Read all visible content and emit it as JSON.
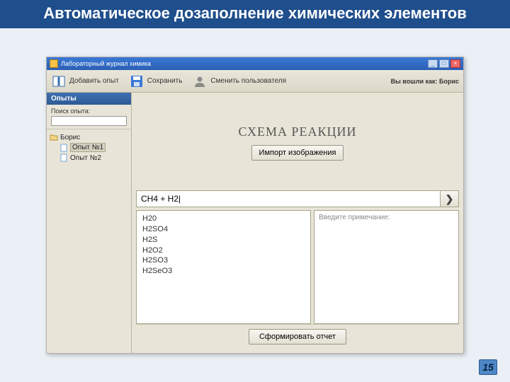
{
  "slide": {
    "title": "Автоматическое дозаполнение химических элементов",
    "page": "15"
  },
  "titlebar": {
    "caption": "Лабораторный журнал химика"
  },
  "toolbar": {
    "add": "Добавить опыт",
    "save": "Сохранить",
    "switchUser": "Сменить пользователя",
    "loggedIn": "Вы вошли как: Борис"
  },
  "sidebar": {
    "header": "Опыты",
    "searchLabel": "Поиск опыта:",
    "tree": {
      "root": "Борис",
      "items": [
        "Опыт №1",
        "Опыт №2"
      ],
      "selectedIndex": 0
    }
  },
  "scheme": {
    "title": "СХЕМА РЕАКЦИИ",
    "importBtn": "Импорт изображения"
  },
  "formula": {
    "value": "CH4 + H2|",
    "suggestions": [
      "H20",
      "H2SO4",
      "H2S",
      "H2O2",
      "H2SO3",
      "H2SeO3"
    ]
  },
  "note": {
    "placeholder": "Введите примечание:"
  },
  "footer": {
    "reportBtn": "Сформировать отчет"
  }
}
